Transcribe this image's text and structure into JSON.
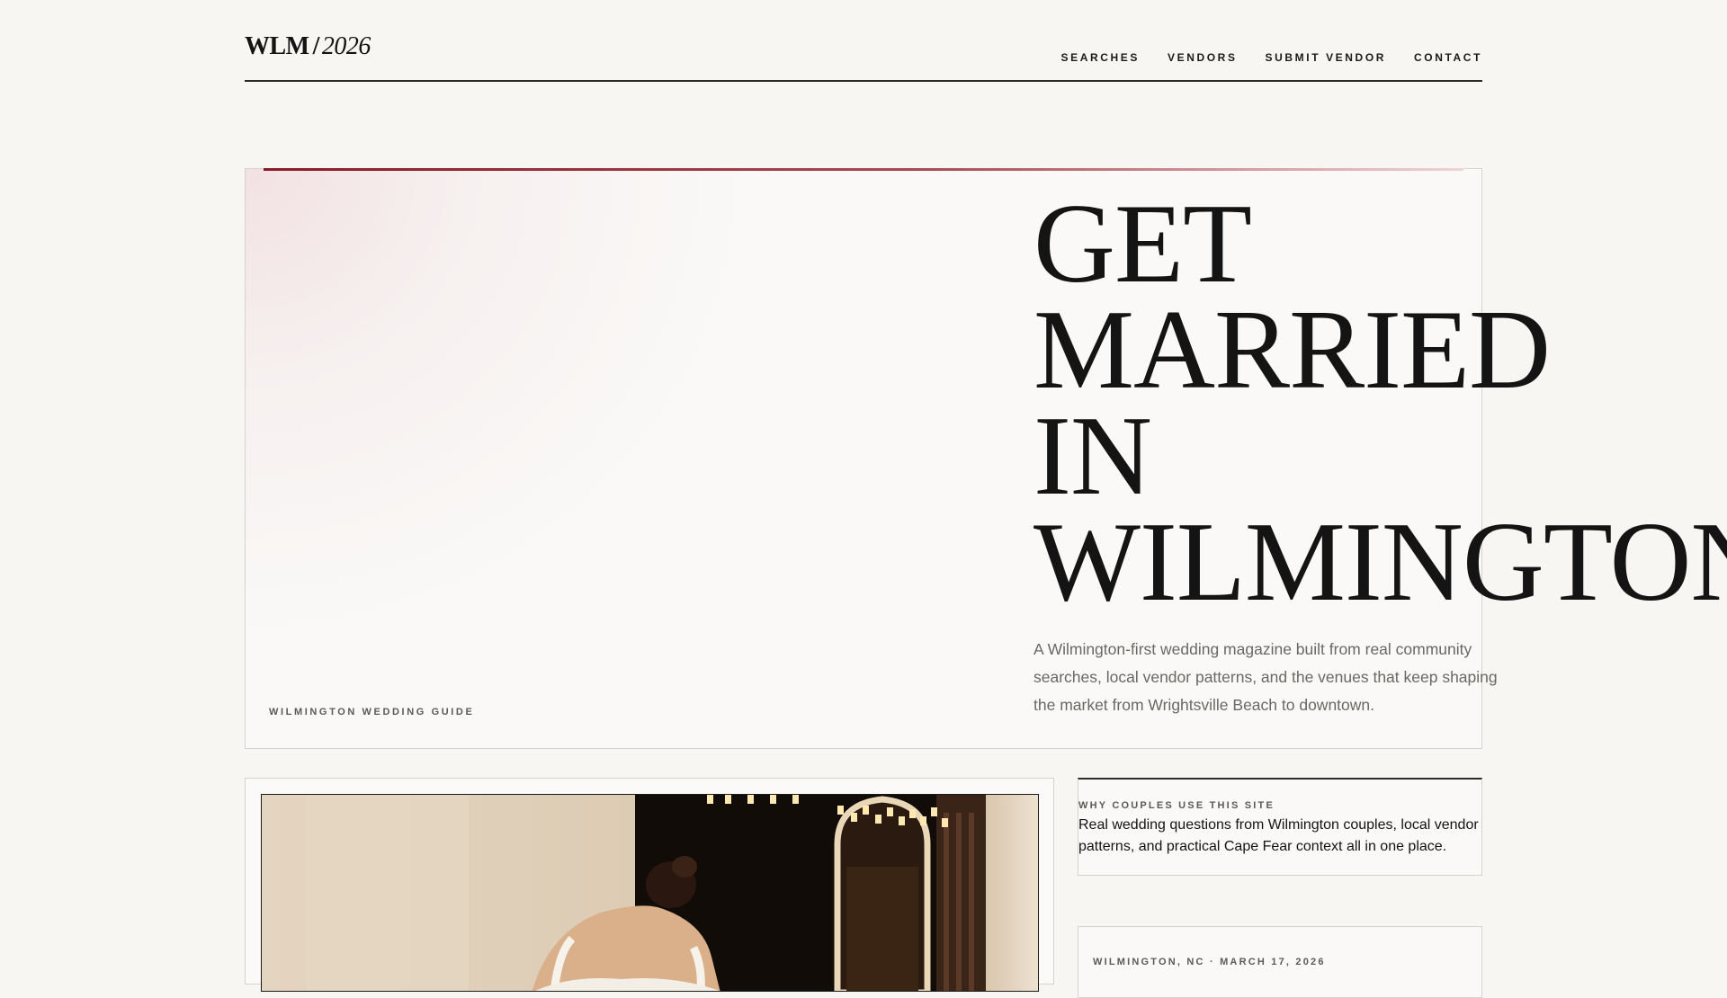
{
  "brand": {
    "mark": "WLM",
    "slash": "/",
    "year": "2026"
  },
  "nav": {
    "items": [
      {
        "label": "SEARCHES"
      },
      {
        "label": "VENDORS"
      },
      {
        "label": "SUBMIT VENDOR"
      },
      {
        "label": "CONTACT"
      }
    ]
  },
  "hero": {
    "kicker": "WILMINGTON WEDDING GUIDE",
    "title_lines": [
      "GET",
      "MARRIED",
      "IN",
      "WILMINGTON"
    ],
    "description": "A Wilmington-first wedding magazine built from real community searches, local vendor patterns, and the venues that keep shaping the market from Wrightsville Beach to downtown."
  },
  "why": {
    "kicker": "WHY COUPLES USE THIS SITE",
    "text": "Real wedding questions from Wilmington couples, local vendor patterns, and practical Cape Fear context all in one place."
  },
  "dateline": {
    "text": "WILMINGTON, NC · MARCH 17, 2026"
  },
  "colors": {
    "background": "#f7f6f3",
    "accent": "#8b1a28",
    "ink": "#141414",
    "muted": "#6a6864"
  }
}
